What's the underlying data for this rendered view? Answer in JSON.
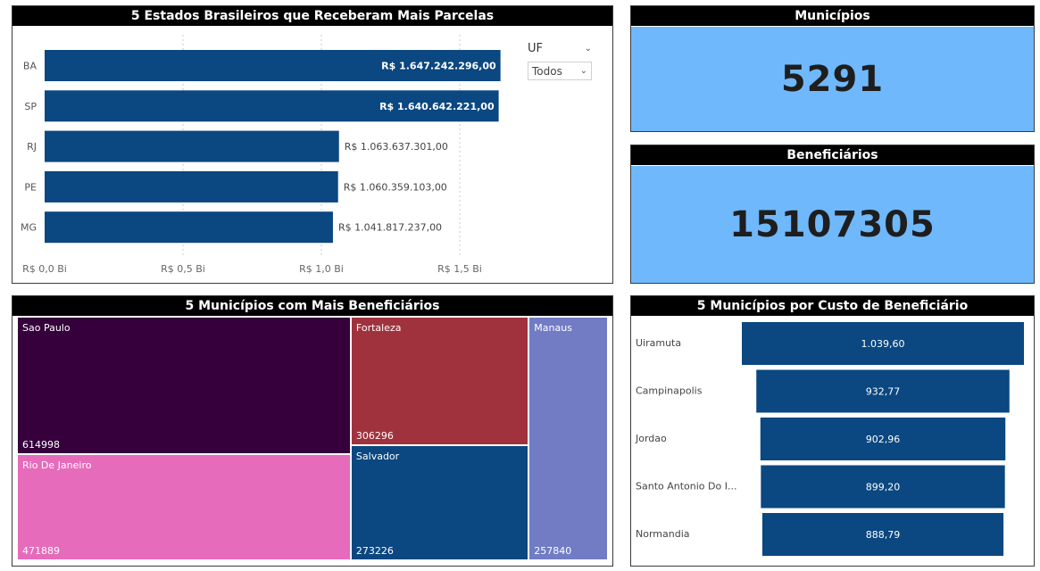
{
  "bar_panel": {
    "title": "5 Estados Brasileiros que Receberam Mais Parcelas"
  },
  "slicer": {
    "label": "UF",
    "value": "Todos"
  },
  "cards": {
    "municipios": {
      "title": "Municípios",
      "value": "5291"
    },
    "beneficiarios": {
      "title": "Beneficiários",
      "value": "15107305"
    }
  },
  "tree_panel": {
    "title": "5 Municípios com Mais Beneficiários"
  },
  "funnel_panel": {
    "title": "5 Municípios por Custo de Beneficiário"
  },
  "chart_data": [
    {
      "type": "bar",
      "orientation": "horizontal",
      "title": "5 Estados Brasileiros que Receberam Mais Parcelas",
      "categories": [
        "BA",
        "SP",
        "RJ",
        "PE",
        "MG"
      ],
      "values": [
        1647242296.0,
        1640642221.0,
        1063637301.0,
        1060359103.0,
        1041817237.0
      ],
      "data_labels": [
        "R$ 1.647.242.296,00",
        "R$ 1.640.642.221,00",
        "R$ 1.063.637.301,00",
        "R$ 1.060.359.103,00",
        "R$ 1.041.817.237,00"
      ],
      "x_ticks": [
        0,
        0.5,
        1.0,
        1.5
      ],
      "x_tick_labels": [
        "R$ 0,0 Bi",
        "R$ 0,5 Bi",
        "R$ 1,0 Bi",
        "R$ 1,5 Bi"
      ],
      "xlim": [
        0,
        1.75
      ],
      "grid": "vertical dotted",
      "color": "#0b4780"
    },
    {
      "type": "treemap",
      "title": "5 Municípios com Mais Beneficiários",
      "items": [
        {
          "label": "Sao Paulo",
          "value": 614998,
          "color": "#35003b"
        },
        {
          "label": "Rio De Janeiro",
          "value": 471889,
          "color": "#e66bbb"
        },
        {
          "label": "Fortaleza",
          "value": 306296,
          "color": "#a0323e"
        },
        {
          "label": "Salvador",
          "value": 273226,
          "color": "#0b4780"
        },
        {
          "label": "Manaus",
          "value": 257840,
          "color": "#717cc5"
        }
      ]
    },
    {
      "type": "funnel",
      "title": "5 Municípios por Custo de Beneficiário",
      "categories": [
        "Uiramuta",
        "Campinapolis",
        "Jordao",
        "Santo Antonio Do I...",
        "Normandia"
      ],
      "values": [
        1039.6,
        932.77,
        902.96,
        899.2,
        888.79
      ],
      "data_labels": [
        "1.039,60",
        "932,77",
        "902,96",
        "899,20",
        "888,79"
      ],
      "color": "#0b4780"
    }
  ]
}
